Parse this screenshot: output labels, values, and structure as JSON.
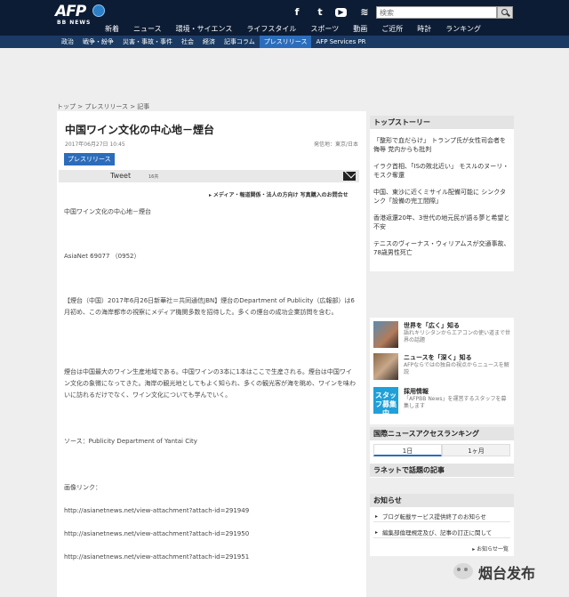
{
  "header": {
    "logo_text": "AFP",
    "logo_sub": "BB NEWS",
    "social": [
      "facebook-icon",
      "twitter-icon",
      "youtube-icon",
      "rss-icon"
    ],
    "search_placeholder": "検索",
    "nav": [
      "新着",
      "ニュース",
      "環境・サイエンス",
      "ライフスタイル",
      "スポーツ",
      "動画",
      "ご近所",
      "時計",
      "ランキング"
    ],
    "subnav": [
      "政治",
      "戦争・紛争",
      "災害・事故・事件",
      "社会",
      "経済",
      "記事コラム",
      "プレスリリース",
      "AFP Services PR"
    ],
    "subnav_active_index": 6
  },
  "breadcrumb": "トップ > プレスリリース > 記事",
  "article": {
    "title": "中国ワイン文化の中心地－煙台",
    "date": "2017年06月27日 10:45",
    "location": "発信地：東京/日本",
    "badge": "プレスリリース",
    "tweet_label": "Tweet",
    "tweet_count": "16共",
    "media_link": "メディア・報道関係・法人の方向け 写真購入のお問合せ",
    "paragraphs": [
      "中国ワイン文化の中心地－煙台",
      "AsiaNet 69077 （0952）",
      "【煙台（中国）2017年6月26日新華社＝共同通信JBN】煙台のDepartment of Publicity（広報部）は6月初め、この海岸都市の視察にメディア機関多数を招待した。多くの煙台の成功企業訪問を含む。",
      "煙台は中国最大のワイン生産地域である。中国ワインの3本に1本はここで生産される。煙台は中国ワイン文化の象徴になってきた。海岸の観光地としてもよく知られ、多くの観光客が海を眺め、ワインを味わいに訪れるだけでなく、ワイン文化についても学んでいく。",
      "ソース：Publicity Department of Yantai City",
      "画像リンク：",
      "http://asianetnews.net/view-attachment?attach-id=291949",
      "http://asianetnews.net/view-attachment?attach-id=291950",
      "http://asianetnews.net/view-attachment?attach-id=291951"
    ]
  },
  "sidebar": {
    "top_stories_heading": "トップストーリー",
    "top_stories": [
      "「整形で血だらけ」 トランプ氏が女性司会者を侮辱 党内からも批判",
      "イラク首相、「ISの敗北近い」 モスルのヌーリ・モスク奪還",
      "中国、東沙に近くミサイル配備可能に シンクタンク「設備の完工間際」",
      "香港返還20年、3世代の地元民が語る夢と希望と不安",
      "テニスのヴィーナス・ウィリアムスが交通事故、78歳男性死亡"
    ],
    "promos": [
      {
        "title": "世界を「広く」知る",
        "desc": "語れキリシタンからエアコンの使い道まで世界の話題"
      },
      {
        "title": "ニュースを「深く」知る",
        "desc": "AFPならではの独自の視点からニュースを解説"
      },
      {
        "title": "採用情報",
        "desc": "「AFPBB News」を運営するスタッフを募集します",
        "thumb_text": "スタッフ募集中"
      }
    ],
    "ranking_heading": "国際ニュースアクセスランキング",
    "ranking_tabs": [
      "1日",
      "1ヶ月"
    ],
    "ranking_tab_active": 0,
    "social_ranking": "ラネットで話題の記事",
    "notice_heading": "お知らせ",
    "notices": [
      "ブログ転載サービス提供終了のお知らせ",
      "編集部倫理規定及び、記事の訂正に関して"
    ],
    "notice_more": "お知らせ一覧"
  },
  "watermark": {
    "text": "烟台发布",
    "icon": "wechat-icon"
  }
}
